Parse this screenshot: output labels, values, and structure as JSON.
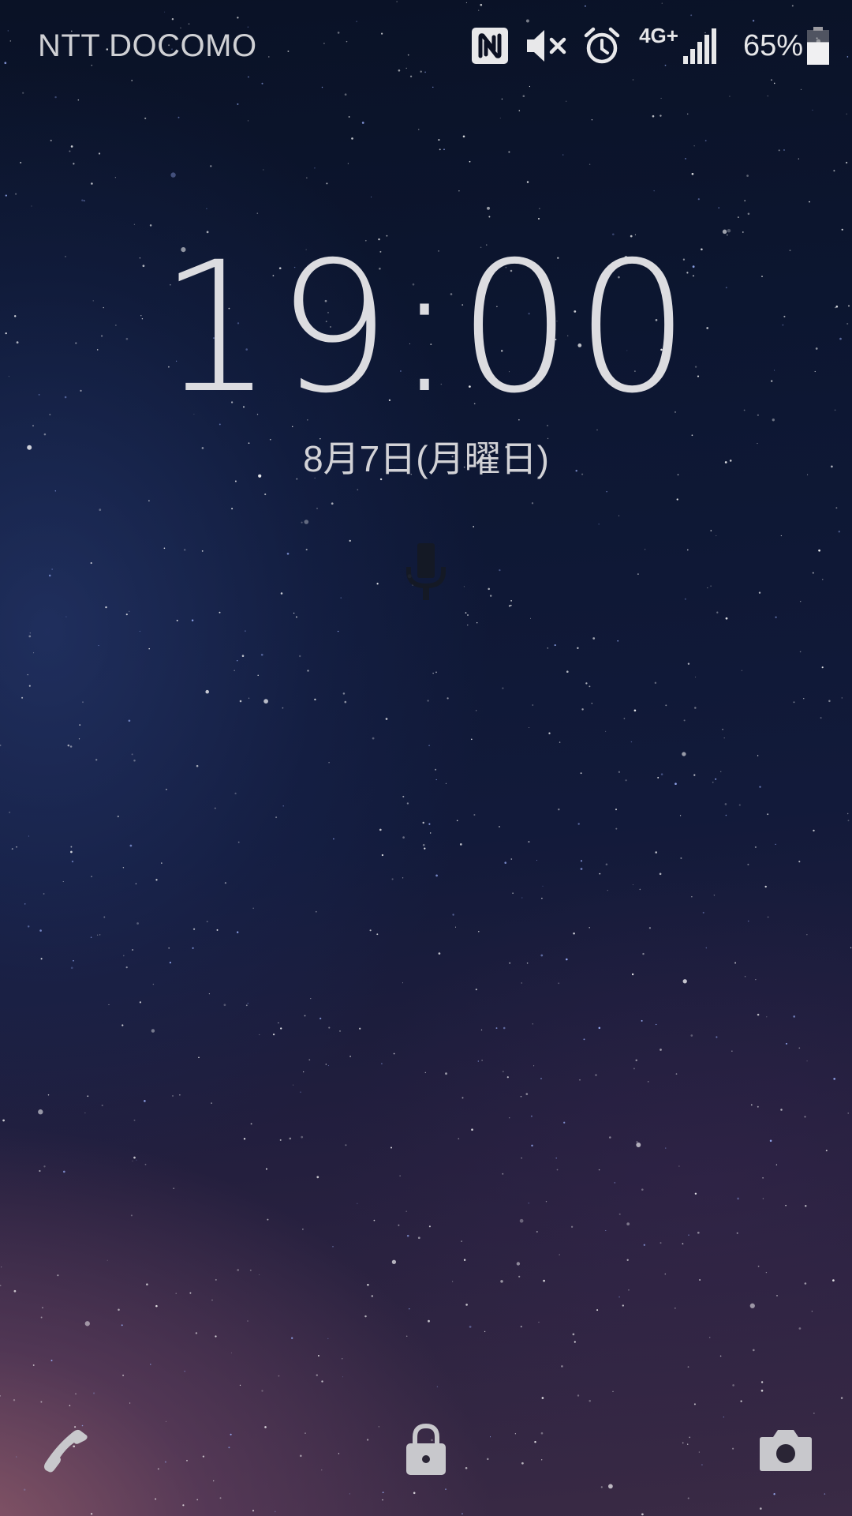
{
  "status_bar": {
    "carrier": "NTT DOCOMO",
    "network_type": "4G+",
    "battery_percent": "65%",
    "battery_level": 0.65,
    "icons": [
      "nfc-icon",
      "mute-icon",
      "alarm-icon",
      "signal-icon",
      "battery-icon"
    ]
  },
  "lockscreen": {
    "time": "19:00",
    "date": "8月7日(月曜日)",
    "center_icon": "mic-icon"
  },
  "shortcuts": {
    "left": "phone-icon",
    "center": "lock-icon",
    "right": "camera-icon"
  },
  "colors": {
    "text": "#dcdce0",
    "icon": "#c8c8cc"
  }
}
